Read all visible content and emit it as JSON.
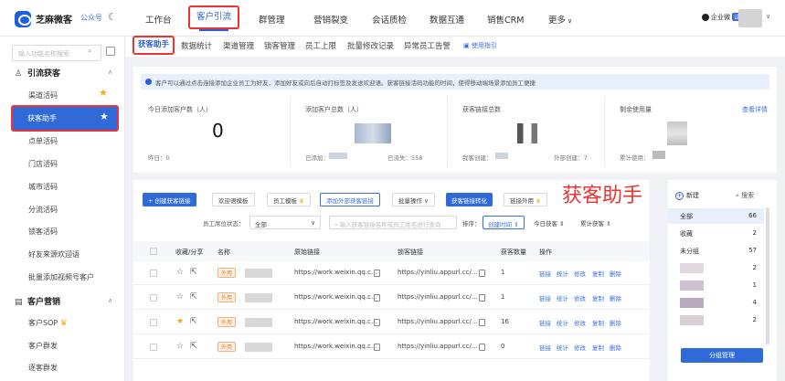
{
  "topbar": {
    "brand": "芝麻微客",
    "gzh": "公众号",
    "nav": [
      "工作台",
      "客户引流",
      "群管理",
      "营销裂变",
      "会话质检",
      "数据互通",
      "销售CRM",
      "更多"
    ],
    "enterprise_label": "企业微",
    "enterprise_tag": "试"
  },
  "sidebar": {
    "search_placeholder": "输入功能名称搜索",
    "sections": [
      {
        "title": "引流获客",
        "items": [
          "渠道活码",
          "获客助手",
          "点单活码",
          "门店活码",
          "城市活码",
          "分流活码",
          "锁客活码",
          "好友来源欢迎语",
          "批量添加视频号客户"
        ]
      },
      {
        "title": "客户营销",
        "items": [
          "客户SOP",
          "客户群发",
          "逐客群发"
        ]
      }
    ]
  },
  "tabs": {
    "items": [
      "获客助手",
      "数据统计",
      "渠道管理",
      "锁客管理",
      "员工上限",
      "批量修改记录",
      "异常员工告警"
    ],
    "guide": "使用指引"
  },
  "notice": "客户可以通过点击连接添加企业员工为好友，添加好友或向后自动打标签及发送欢迎语。获客链接活码功能的时间，使得移动端场景添加员工便捷",
  "stats": {
    "today": {
      "label": "今日添加客户数（人）",
      "value": "0",
      "foot": "昨日：0"
    },
    "total": {
      "label": "添加客户总数（人）",
      "foot_added": "已添加：",
      "foot_lost": "已流失：558"
    },
    "links": {
      "label": "获客链接总数",
      "foot_created": "我客创建：",
      "foot_external": "外部创建：7"
    },
    "remain": {
      "label": "剩余使用量",
      "link": "查看详情",
      "foot": "累计使用："
    }
  },
  "toolbar": {
    "create": "+ 创建获客链接",
    "welcome": "欢迎语模板",
    "staff_tpl": "员工模板",
    "add_external": "添加外部获客链接",
    "batch": "批量操作",
    "convert": "获客链接转化",
    "external_use": "链接外用"
  },
  "filters": {
    "staff_status_label": "员工席位状态：",
    "staff_status_value": "全部",
    "search_placeholder": "输入获客链接名称或员工姓名进行查询",
    "sort_label": "排序：",
    "sort_created": "创建时间",
    "sort_today": "今日获客",
    "sort_total": "累计获客"
  },
  "table": {
    "headers": [
      "收藏/分享",
      "名称",
      "原始链接",
      "锁客链接",
      "获客数量",
      "操作"
    ],
    "rows": [
      {
        "tag": "外用",
        "orig": "https://work.weixin.qq.c...",
        "lock": "https://yinliu.appurl.cc/...",
        "count": "1",
        "starred": false
      },
      {
        "tag": "外用",
        "orig": "https://work.weixin.qq.c...",
        "lock": "https://yinliu.appurl.cc/...",
        "count": "1",
        "starred": false
      },
      {
        "tag": "外用",
        "orig": "https://work.weixin.qq.c...",
        "lock": "https://yinliu.appurl.cc/...",
        "count": "16",
        "starred": true
      },
      {
        "tag": "外用",
        "orig": "https://work.weixin.qq.c...",
        "lock": "https://yinliu.appurl.cc/...",
        "count": "0",
        "starred": false
      }
    ],
    "ops": [
      "链接",
      "统计",
      "修改",
      "复制",
      "删除"
    ]
  },
  "overlay_title": "获客助手",
  "groups": {
    "new": "新建",
    "search": "搜索",
    "items": [
      {
        "name": "全部",
        "count": "66"
      },
      {
        "name": "收藏",
        "count": "2"
      },
      {
        "name": "未分组",
        "count": "57"
      },
      {
        "name": "",
        "count": "2"
      },
      {
        "name": "",
        "count": "1"
      },
      {
        "name": "",
        "count": "4"
      },
      {
        "name": "",
        "count": "2"
      }
    ],
    "manage": "分组管理"
  }
}
